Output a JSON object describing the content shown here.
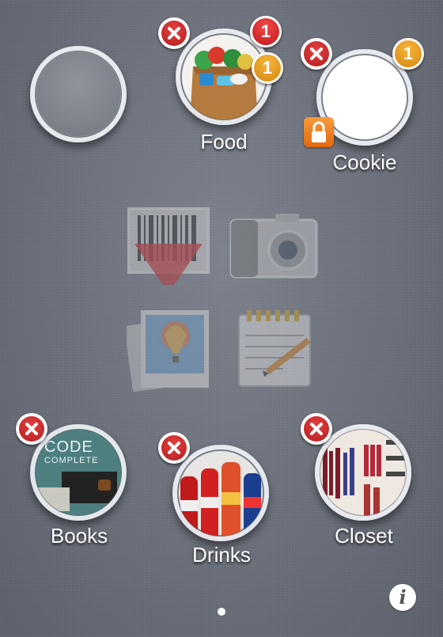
{
  "items": {
    "empty": {
      "label": ""
    },
    "food": {
      "label": "Food",
      "badge_red": "1",
      "badge_orange": "1"
    },
    "cookie": {
      "label": "Cookie",
      "badge_orange": "1"
    },
    "books": {
      "label": "Books",
      "cover_title": "CODE",
      "cover_subtitle": "COMPLETE"
    },
    "drinks": {
      "label": "Drinks"
    },
    "closet": {
      "label": "Closet"
    }
  },
  "tools": [
    "barcode-scanner-icon",
    "camera-icon",
    "photos-icon",
    "notepad-icon"
  ],
  "page_indicator": {
    "pages": 1,
    "current": 1
  },
  "info_button": {
    "glyph": "i"
  },
  "colors": {
    "delete": "#c8282a",
    "badge_red": "#d81e24",
    "badge_orange": "#e8a020",
    "lock": "#ee7d22"
  }
}
